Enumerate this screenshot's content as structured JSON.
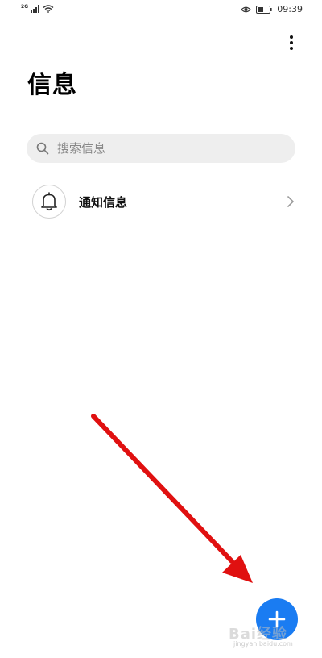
{
  "status_bar": {
    "network_type": "2G",
    "time": "09:39"
  },
  "header": {
    "title": "信息",
    "more_icon": "more-vertical-icon"
  },
  "search": {
    "placeholder": "搜索信息",
    "icon": "search-icon"
  },
  "conversations": [
    {
      "label": "通知信息",
      "icon": "bell-icon"
    }
  ],
  "fab": {
    "icon": "plus-icon",
    "color": "#1a7cf2"
  },
  "annotation": {
    "arrow_color": "#e01010"
  },
  "watermark": {
    "text": "Bai经验",
    "sub": "jingyan.baidu.com"
  }
}
